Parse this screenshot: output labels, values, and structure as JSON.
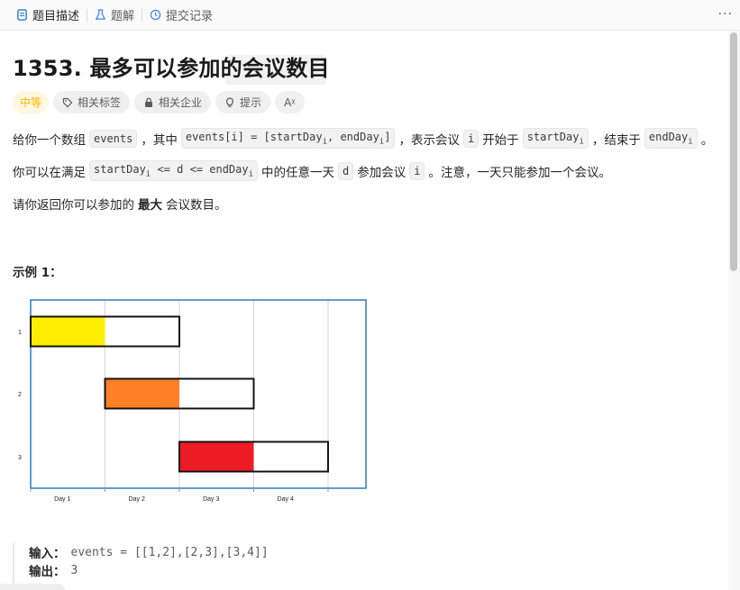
{
  "tabs": [
    {
      "label": "题目描述",
      "icon": "document-icon"
    },
    {
      "label": "题解",
      "icon": "flask-icon"
    },
    {
      "label": "提交记录",
      "icon": "history-icon"
    }
  ],
  "more_label": "···",
  "problem": {
    "title": "1353. 最多可以参加的会议数目",
    "difficulty": "中等",
    "difficulty_color": "#ffb800",
    "tags": [
      {
        "label": "相关标签",
        "icon": "tag-icon"
      },
      {
        "label": "相关企业",
        "icon": "lock-icon"
      },
      {
        "label": "提示",
        "icon": "lightbulb-icon"
      }
    ],
    "translate_label": "Aᵡ",
    "desc1": {
      "t1": "给你一个数组",
      "c1": "events",
      "t2": "，其中",
      "c2a": "events[i] = [startDay",
      "c2sub1": "i",
      "c2b": ", endDay",
      "c2sub2": "i",
      "c2c": "]",
      "t3": "，表示会议",
      "c3": "i",
      "t4": "开始于",
      "c4": "startDay",
      "c4sub": "i",
      "t5": "，结束于",
      "c5": "endDay",
      "c5sub": "i",
      "t6": "。"
    },
    "desc2": {
      "t1": "你可以在满足",
      "c1a": "startDay",
      "c1sub1": "i",
      "c1b": " <= d <= endDay",
      "c1sub2": "i",
      "t2": "中的任意一天",
      "c2": "d",
      "t3": "参加会议",
      "c3": "i",
      "t4": "。注意，一天只能参加一个会议。"
    },
    "desc3": {
      "t1": "请你返回你可以参加的",
      "bold": "最大",
      "t2": "会议数目。"
    },
    "example_title": "示例 1：",
    "input_label": "输入：",
    "input_value": "events = [[1,2],[2,3],[3,4]]",
    "output_label": "输出：",
    "output_value": "3"
  },
  "chart_data": {
    "type": "gantt",
    "title": "",
    "xlabel": "",
    "ylabel": "",
    "x_tick_labels": [
      "Day 1",
      "Day 2",
      "Day 3",
      "Day 4"
    ],
    "y_tick_labels": [
      "1",
      "2",
      "3"
    ],
    "grid": true,
    "events": [
      {
        "row": "1",
        "start": 1,
        "end": 2,
        "attended_day": 1,
        "color": "#ffee00"
      },
      {
        "row": "2",
        "start": 2,
        "end": 3,
        "attended_day": 2,
        "color": "#ff7f27"
      },
      {
        "row": "3",
        "start": 3,
        "end": 4,
        "attended_day": 3,
        "color": "#ed1c24"
      }
    ],
    "frame_color": "#2b7bc4"
  }
}
